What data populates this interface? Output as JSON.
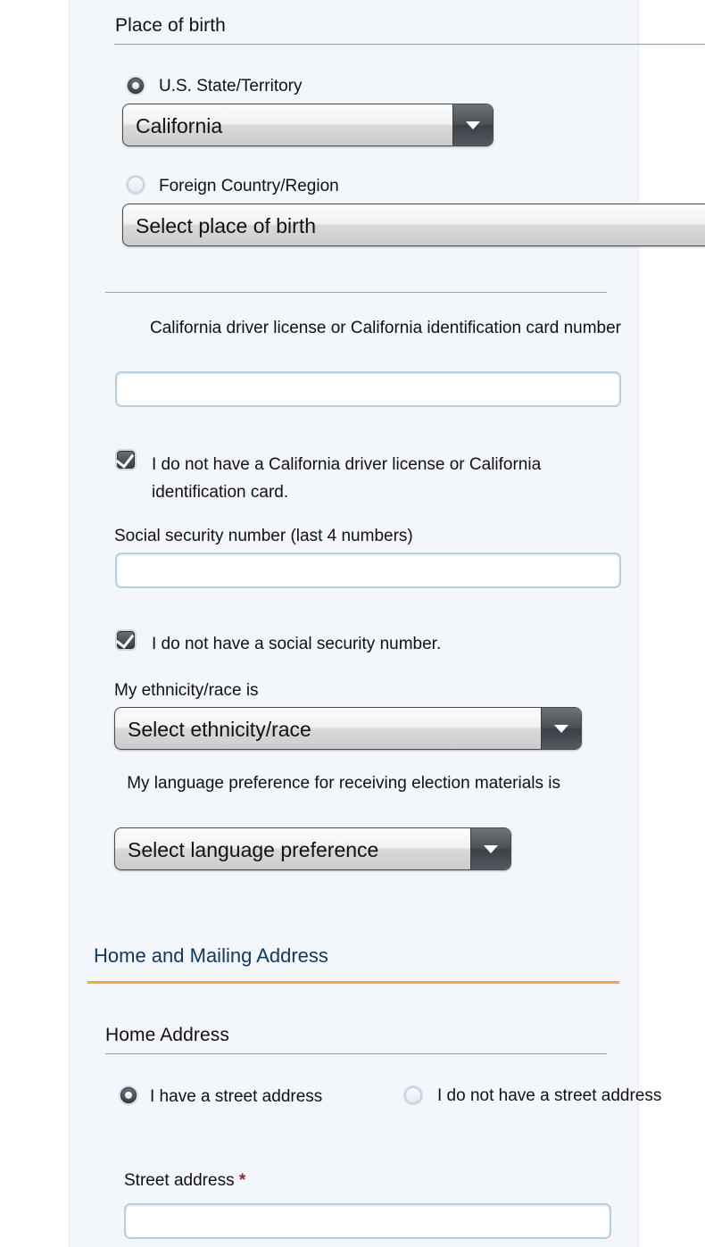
{
  "colors": {
    "panel_bg": "#f3f7fb",
    "section_heading": "#0f3a63",
    "section_rule": "#eeaa3c",
    "required_asterisk": "#9c2026",
    "input_border": "#b6cede",
    "radio_halo": "#c9dbe8"
  },
  "place_of_birth": {
    "heading": "Place of birth",
    "options": [
      {
        "label": "U.S. State/Territory",
        "selected": true
      },
      {
        "label": "Foreign Country/Region",
        "selected": false
      }
    ],
    "state_select": {
      "value": "California"
    },
    "foreign_select": {
      "value": "Select place of birth"
    }
  },
  "identification": {
    "dl_label": "California driver license or California identification card number",
    "dl_value": "",
    "dl_checkbox": {
      "label": "I do not have a California driver license or California identification card.",
      "checked": true
    },
    "ssn_label": "Social security number (last 4 numbers)",
    "ssn_value": "",
    "ssn_checkbox": {
      "label": "I do not have a social security number.",
      "checked": true
    },
    "ethnicity_label": "My ethnicity/race is",
    "ethnicity_select": {
      "value": "Select ethnicity/race"
    },
    "language_label": "My language preference for receiving election materials is",
    "language_select": {
      "value": "Select language preference"
    }
  },
  "home_and_mailing": {
    "section_heading": "Home and Mailing Address",
    "home_address": {
      "heading": "Home Address",
      "options": [
        {
          "label": "I have a street address",
          "selected": true
        },
        {
          "label": "I do not have a street address",
          "selected": false
        }
      ],
      "street_label": "Street address",
      "street_required_marker": "*",
      "street_value": ""
    }
  }
}
